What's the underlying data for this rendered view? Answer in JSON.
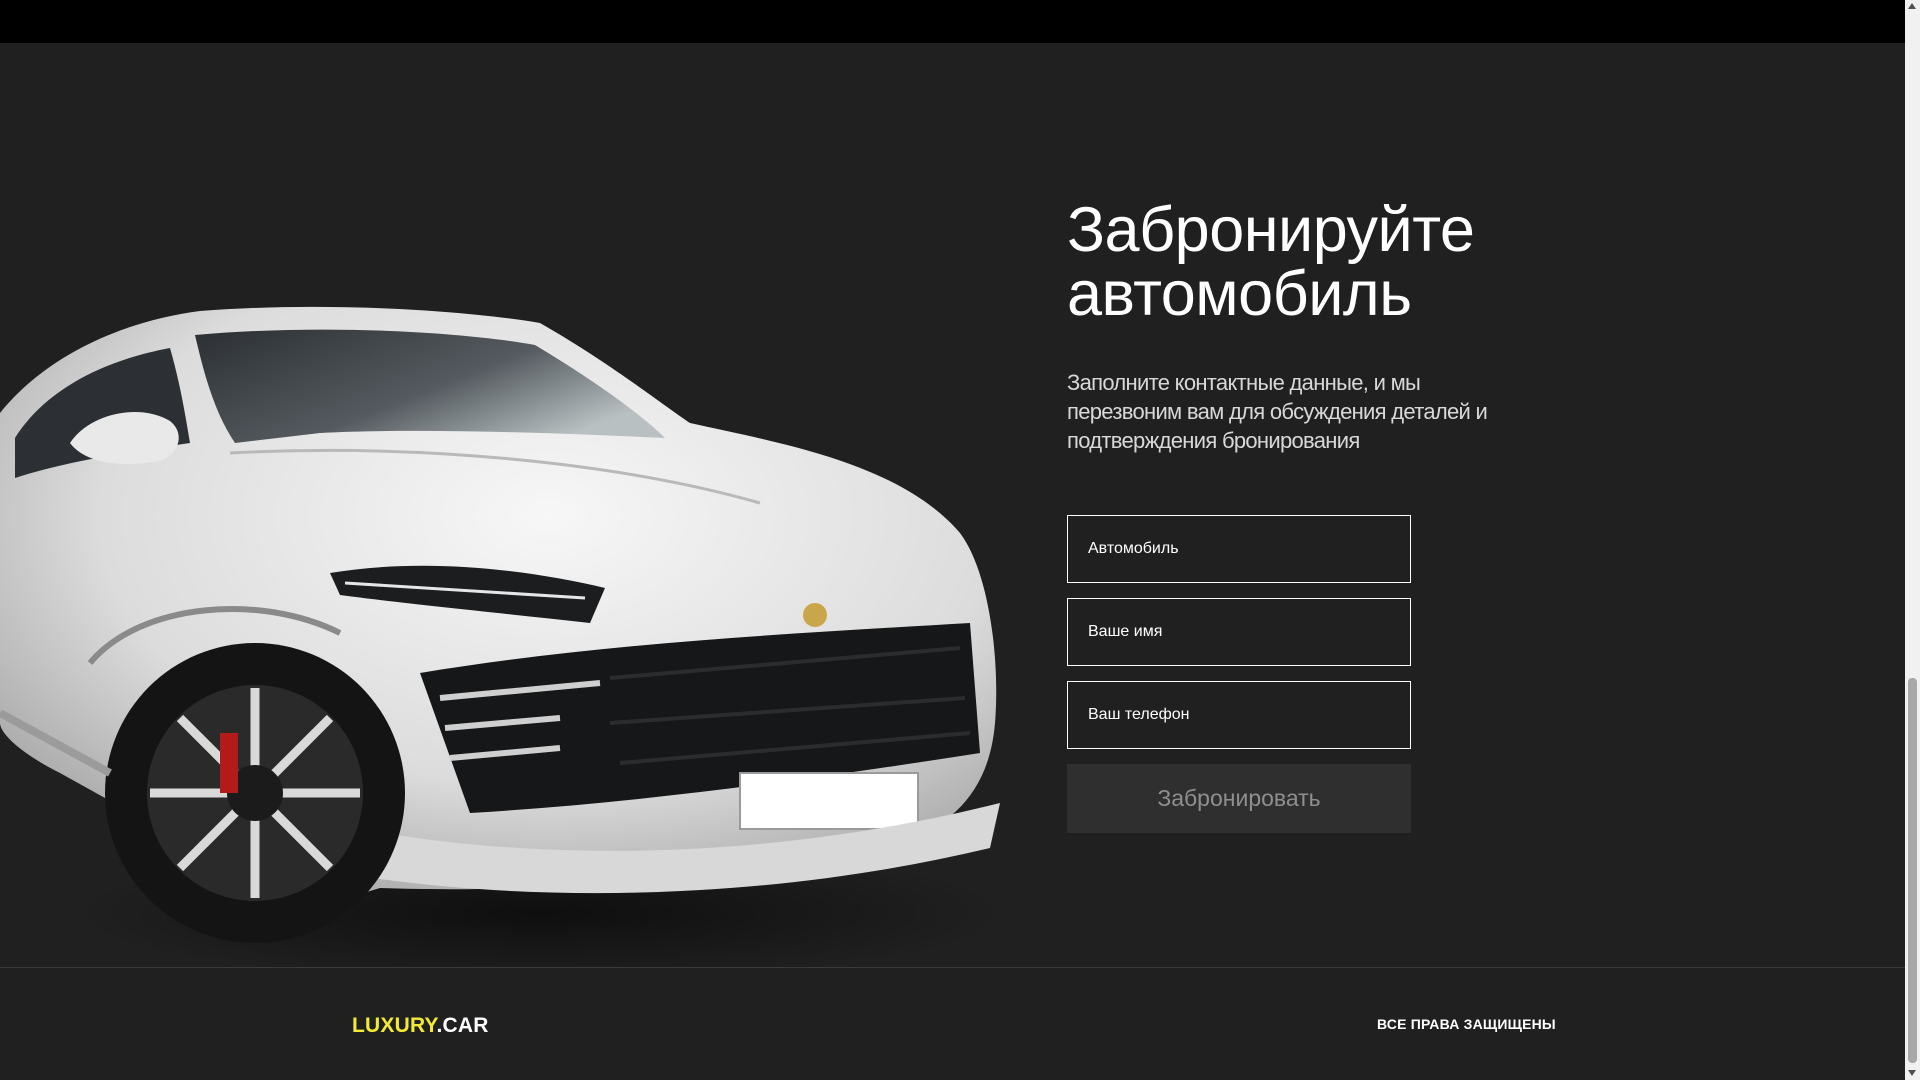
{
  "booking": {
    "title": "Забронируйте\nавтомобиль",
    "lead": "Заполните контактные данные, и мы перезвоним вам для обсуждения деталей и подтверждения бронирования",
    "fields": {
      "car_placeholder": "Автомобиль",
      "name_placeholder": "Ваше имя",
      "phone_placeholder": "Ваш телефон"
    },
    "submit_label": "Забронировать"
  },
  "footer": {
    "logo_accent": "LUXURY",
    "logo_rest": ".CAR",
    "rights": "ВСЕ ПРАВА ЗАЩИЩЕНЫ"
  },
  "colors": {
    "accent": "#f2ea34",
    "background": "#202020",
    "topbar": "#000000"
  },
  "icons": {
    "scroll_up": "triangle-up",
    "scroll_down": "triangle-down"
  }
}
